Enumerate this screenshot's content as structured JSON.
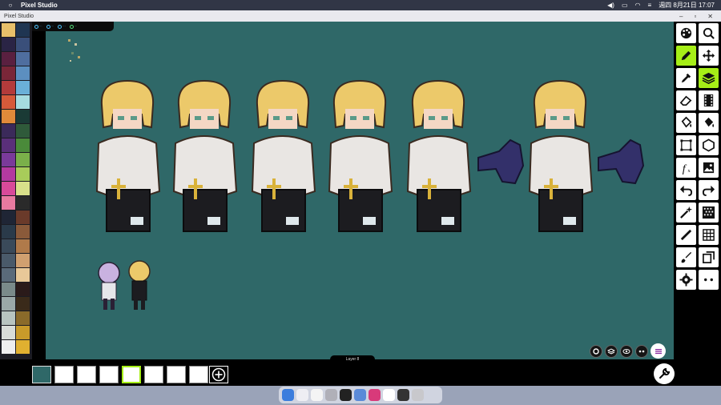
{
  "menubar": {
    "app_name": "Pixel Studio",
    "datetime": "週四 8月21日 17:07"
  },
  "window": {
    "title": "Pixel Studio"
  },
  "palette": {
    "colors": [
      "#e8c06a",
      "#1f3552",
      "#2a2445",
      "#3a4f7a",
      "#5a2040",
      "#4f6e9f",
      "#7a2638",
      "#5c8fc0",
      "#b33b3b",
      "#6ab0d8",
      "#d65a3a",
      "#a6dce0",
      "#e08a3a",
      "#1a3a35",
      "#3b2a5a",
      "#2f5a3a",
      "#5a2f7a",
      "#4a8a3a",
      "#7a3a9a",
      "#7ab04a",
      "#b33aa0",
      "#a8cc5a",
      "#d84a9a",
      "#d8e08a",
      "#e87aa0",
      "#2a2a2a",
      "#1f2535",
      "#6a3a2a",
      "#2a3a4a",
      "#8a5a3a",
      "#3a4a5a",
      "#b07a4a",
      "#4a5a6a",
      "#d0a070",
      "#5a6a7a",
      "#e8c898",
      "#7a8a8a",
      "#2a1a1a",
      "#9aa8a8",
      "#3a2a1a",
      "#b8c4c0",
      "#8a6a2a",
      "#d8dcd8",
      "#c89a2a",
      "#eeeeee",
      "#e0b030"
    ]
  },
  "layer": {
    "label": "Layer 8"
  },
  "frames": {
    "count": 8,
    "current_index": 0,
    "selected_index": 4
  },
  "colors": {
    "canvas_bg": "#2f6868",
    "accent": "#a6ee17"
  },
  "tools": [
    {
      "name": "palette-icon",
      "active": false
    },
    {
      "name": "zoom-icon",
      "active": false
    },
    {
      "name": "pencil-icon",
      "active": true
    },
    {
      "name": "move-icon",
      "active": false
    },
    {
      "name": "eyedropper-icon",
      "active": false
    },
    {
      "name": "layers-icon",
      "active": true
    },
    {
      "name": "eraser-icon",
      "active": false
    },
    {
      "name": "film-icon",
      "active": false
    },
    {
      "name": "fill-bucket-icon",
      "active": false
    },
    {
      "name": "fill-bucket-alt-icon",
      "active": false
    },
    {
      "name": "select-rect-icon",
      "active": false
    },
    {
      "name": "shape-icon",
      "active": false
    },
    {
      "name": "function-icon",
      "active": false
    },
    {
      "name": "image-icon",
      "active": false
    },
    {
      "name": "undo-icon",
      "active": false
    },
    {
      "name": "redo-icon",
      "active": false
    },
    {
      "name": "magic-wand-icon",
      "active": false
    },
    {
      "name": "dither-icon",
      "active": false
    },
    {
      "name": "line-icon",
      "active": false
    },
    {
      "name": "grid-icon",
      "active": false
    },
    {
      "name": "brush-icon",
      "active": false
    },
    {
      "name": "copy-icon",
      "active": false
    },
    {
      "name": "settings-icon",
      "active": false
    },
    {
      "name": "more-icon",
      "active": false
    }
  ]
}
